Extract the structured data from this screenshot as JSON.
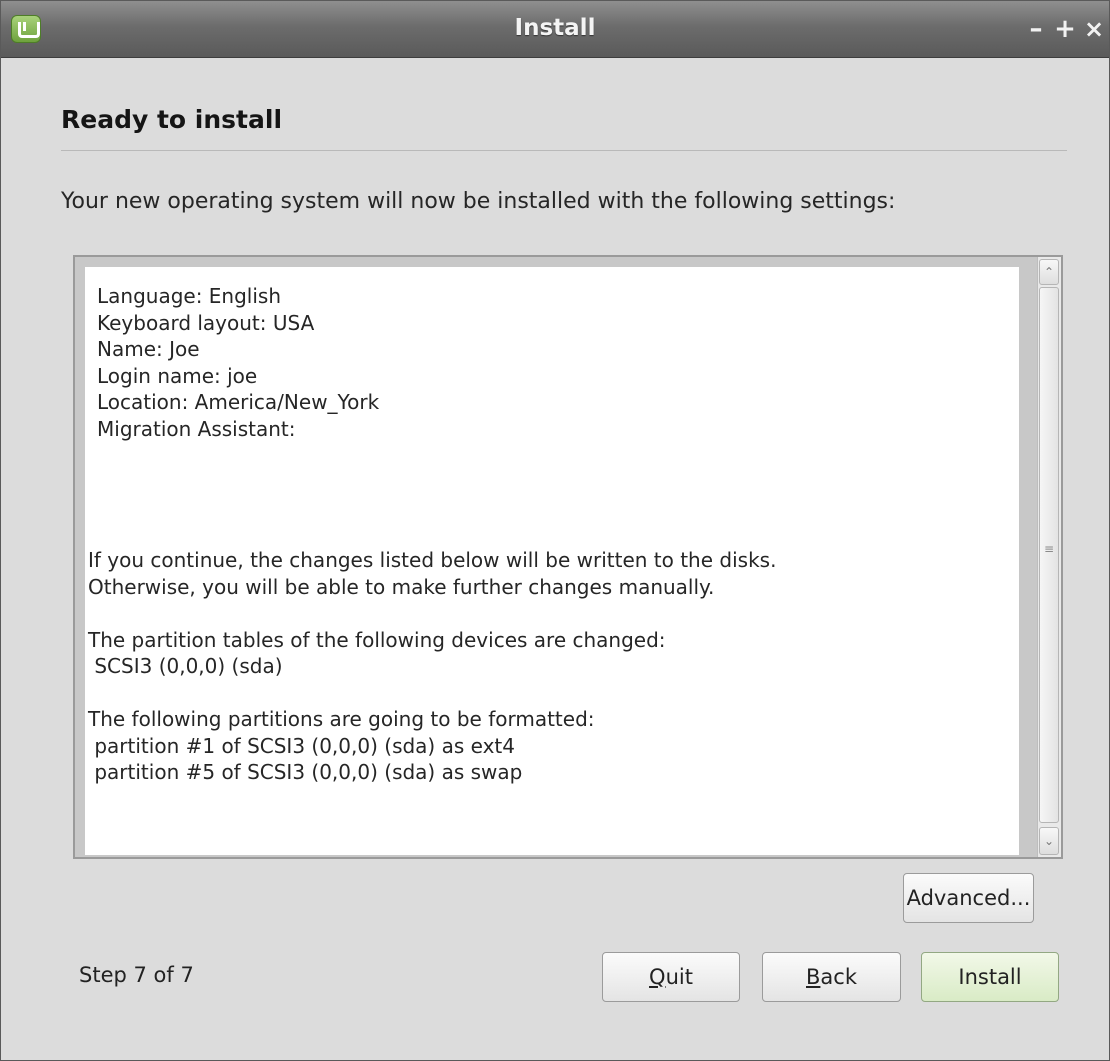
{
  "window": {
    "title": "Install",
    "controls": {
      "minimize": "–",
      "maximize": "+",
      "close": "×"
    }
  },
  "page": {
    "heading": "Ready to install",
    "intro": "Your new operating system will now be installed with the following settings:"
  },
  "summary": {
    "settings": [
      "Language: English",
      "Keyboard layout: USA",
      "Name: Joe",
      "Login name: joe",
      "Location: America/New_York",
      "Migration Assistant:"
    ],
    "notes": [
      "If you continue, the changes listed below will be written to the disks.",
      "Otherwise, you will be able to make further changes manually.",
      "",
      "The partition tables of the following devices are changed:",
      " SCSI3 (0,0,0) (sda)",
      "",
      "The following partitions are going to be formatted:",
      " partition #1 of SCSI3 (0,0,0) (sda) as ext4",
      " partition #5 of SCSI3 (0,0,0) (sda) as swap"
    ]
  },
  "buttons": {
    "advanced": "Advanced...",
    "quit": {
      "mnemonic": "Q",
      "rest": "uit"
    },
    "back": {
      "mnemonic": "B",
      "rest": "ack"
    },
    "install": "Install"
  },
  "footer": {
    "step": "Step 7 of 7"
  },
  "colors": {
    "titlebar": "#6c6c6c",
    "background": "#dcdcdc",
    "install_button": "#d9ebc6",
    "app_icon": "#8bbd55"
  },
  "icons": {
    "app": "linux-mint-icon",
    "scroll_grip": "≡"
  }
}
